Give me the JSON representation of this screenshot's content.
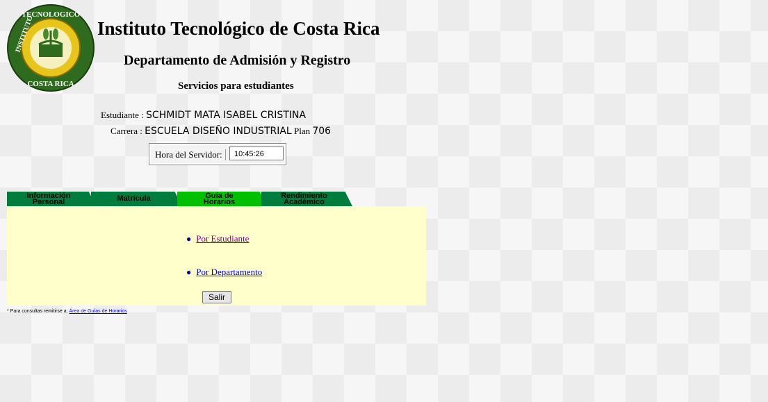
{
  "header": {
    "title": "Instituto Tecnológico de Costa Rica",
    "subtitle": "Departamento de Admisión y Registro",
    "services": "Servicios para estudiantes",
    "logo_text_top": "TECNOLOGICO",
    "logo_text_left": "INSTITUTO",
    "logo_text_bottom": "COSTA RICA"
  },
  "student": {
    "student_label": "Estudiante :",
    "student_name": "SCHMIDT MATA ISABEL CRISTINA",
    "career_label": "Carrera :",
    "career_name": "ESCUELA DISEÑO INDUSTRIAL",
    "plan_label": "Plan",
    "plan_number": "706"
  },
  "server": {
    "label": "Hora del Servidor:",
    "time": "10:45:26"
  },
  "tabs": [
    {
      "line1": "Información",
      "line2": "Personal"
    },
    {
      "line1": "Matrícula",
      "line2": ""
    },
    {
      "line1": "Guía de",
      "line2": "Horarios"
    },
    {
      "line1": "Rendimiento",
      "line2": "Académico"
    }
  ],
  "panel": {
    "link_student": "Por Estudiante",
    "link_department": "Por Departamento",
    "exit_label": "Salir"
  },
  "footer": {
    "note": "* Para consultas remitirse a:",
    "link": "Área de Guías de Horarios"
  },
  "colors": {
    "tab_inactive": "#007c3c",
    "tab_active": "#00c000",
    "panel_bg": "#ffffcc"
  }
}
